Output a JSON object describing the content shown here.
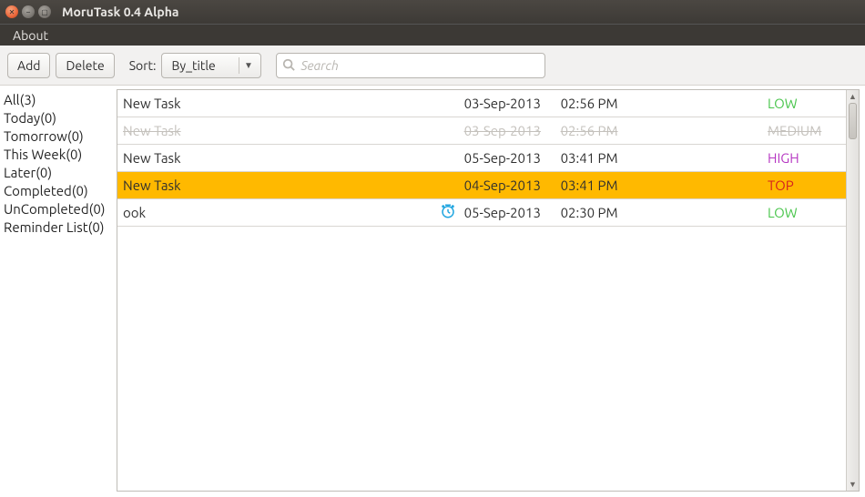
{
  "window": {
    "title": "MoruTask 0.4 Alpha"
  },
  "menubar": {
    "about": "About"
  },
  "toolbar": {
    "add_label": "Add",
    "delete_label": "Delete",
    "sort_label": "Sort:",
    "sort_value": "By_title",
    "search_placeholder": "Search"
  },
  "sidebar": {
    "items": [
      {
        "label": "All(3)"
      },
      {
        "label": "Today(0)"
      },
      {
        "label": "Tomorrow(0)"
      },
      {
        "label": "This Week(0)"
      },
      {
        "label": "Later(0)"
      },
      {
        "label": "Completed(0)"
      },
      {
        "label": "UnCompleted(0)"
      },
      {
        "label": "Reminder List(0)"
      }
    ]
  },
  "tasks": [
    {
      "title": "New Task",
      "date": "03-Sep-2013",
      "time": "02:56 PM",
      "priority": "LOW",
      "prio_class": "prio-low",
      "reminder": false,
      "state": ""
    },
    {
      "title": "New Task",
      "date": "03-Sep-2013",
      "time": "02:56 PM",
      "priority": "MEDIUM",
      "prio_class": "prio-medium",
      "reminder": false,
      "state": "completed"
    },
    {
      "title": "New Task",
      "date": "05-Sep-2013",
      "time": "03:41 PM",
      "priority": "HIGH",
      "prio_class": "prio-high",
      "reminder": false,
      "state": ""
    },
    {
      "title": "New Task",
      "date": "04-Sep-2013",
      "time": "03:41 PM",
      "priority": "TOP",
      "prio_class": "prio-top",
      "reminder": false,
      "state": "selected"
    },
    {
      "title": "ook",
      "date": "05-Sep-2013",
      "time": "02:30 PM",
      "priority": "LOW",
      "prio_class": "prio-low",
      "reminder": true,
      "state": ""
    }
  ]
}
